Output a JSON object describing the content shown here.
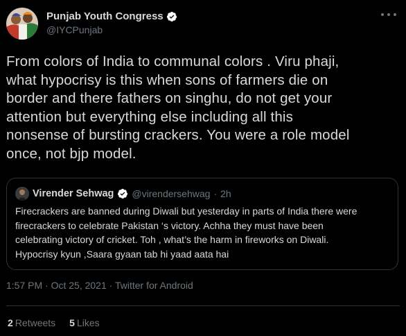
{
  "tweet": {
    "display_name": "Punjab Youth Congress",
    "handle": "@IYCPunjab",
    "text_lines": [
      "From colors of India to communal colors . Viru phaji,",
      "what hypocrisy is this when sons of farmers die on",
      "border and there fathers on singhu, do not get your",
      "attention but everything else including all this",
      "nonsense of bursting crackers. You were a role model",
      "once, not bjp model."
    ],
    "time": "1:57 PM",
    "date": "Oct 25, 2021",
    "source": "Twitter for Android",
    "retweet_count": "2",
    "retweet_label": "Retweets",
    "like_count": "5",
    "like_label": "Likes"
  },
  "quoted_tweet": {
    "display_name": "Virender Sehwag",
    "handle": "@virendersehwag",
    "time_ago": "2h",
    "text_lines": [
      "Firecrackers are banned during Diwali but yesterday in parts of India there were",
      "firecrackers to celebrate Pakistan ‘s victory. Achha they must have been",
      "celebrating victory of cricket. Toh , what’s the harm in fireworks on Diwali.",
      "Hypocrisy kyun ,Saara gyaan tab hi yaad aata hai"
    ]
  },
  "colors": {
    "background": "#000000",
    "text_primary": "#d9d9d9",
    "text_secondary": "#6e767d",
    "border": "#2f3336",
    "verified": "#ffffff"
  },
  "icons": [
    "avatar",
    "verified-badge-icon",
    "more-options-icon"
  ]
}
